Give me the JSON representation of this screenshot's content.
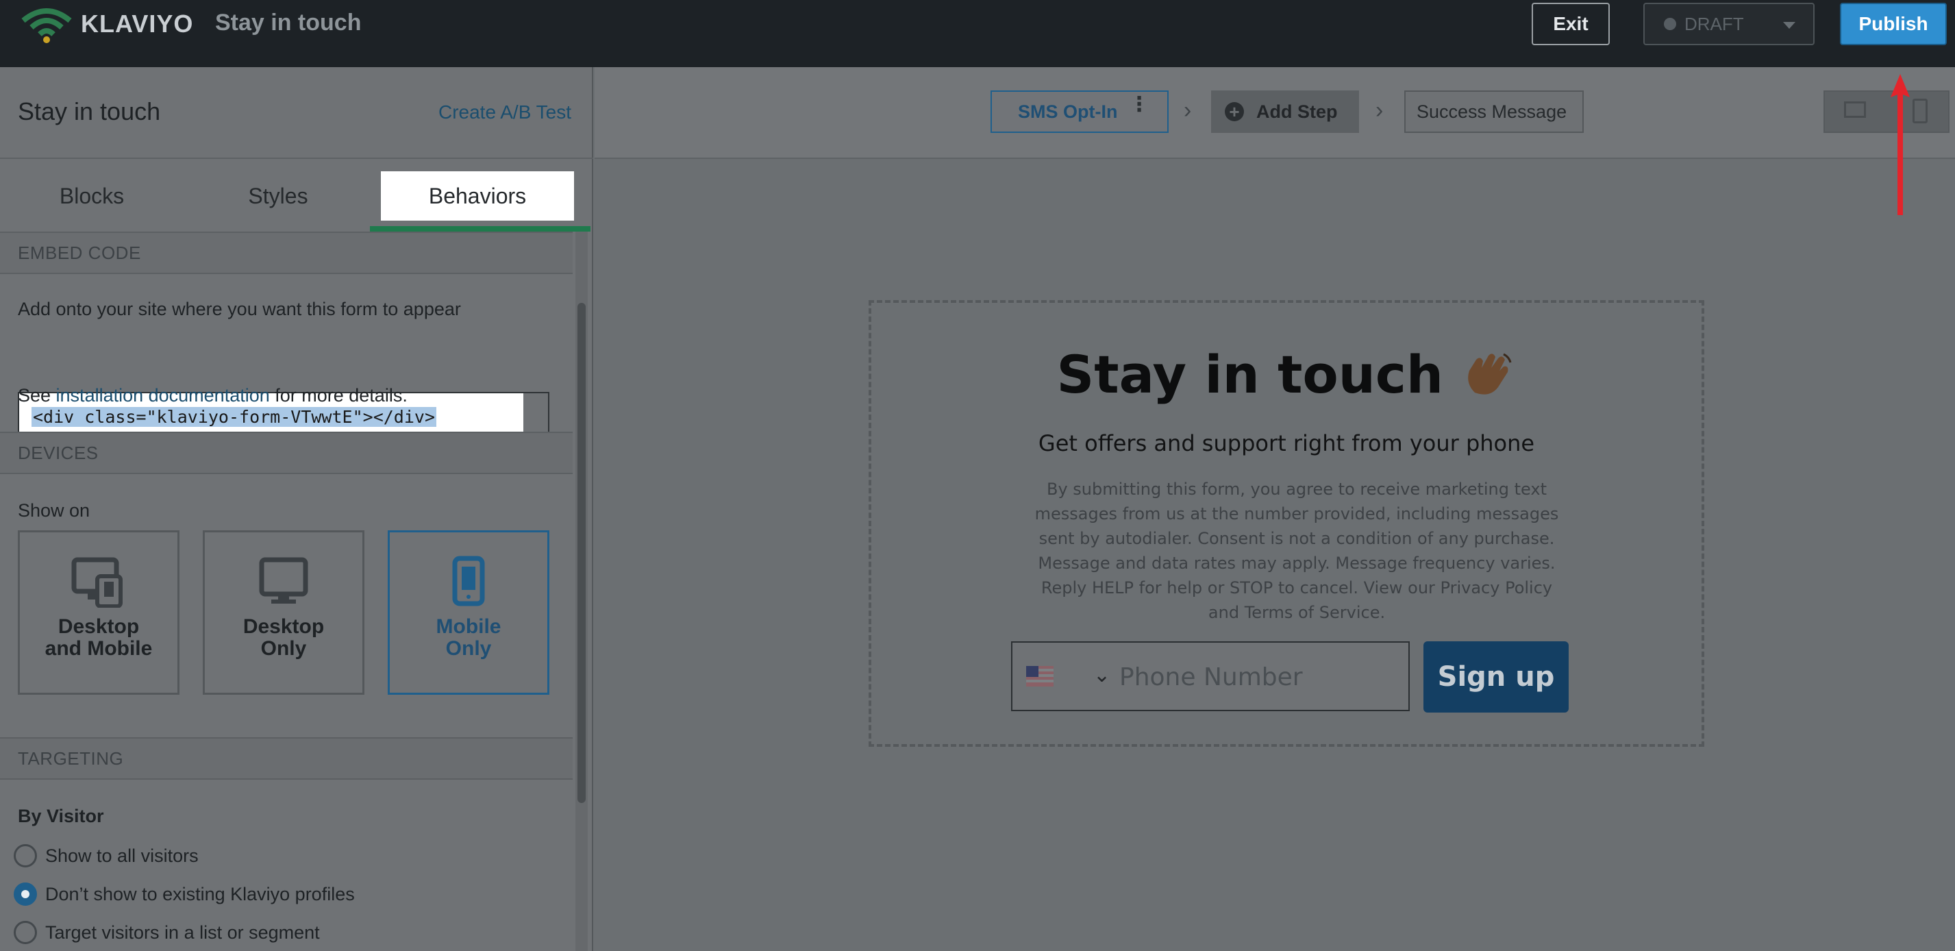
{
  "topbar": {
    "brand": "KLAVIYO",
    "app_title": "Stay in touch",
    "exit_label": "Exit",
    "status_label": "DRAFT",
    "publish_label": "Publish"
  },
  "left_panel": {
    "title": "Stay in touch",
    "ab_test_link": "Create A/B Test",
    "tabs": [
      {
        "label": "Blocks"
      },
      {
        "label": "Styles"
      },
      {
        "label": "Behaviors",
        "active": true
      }
    ],
    "embed": {
      "heading": "EMBED CODE",
      "instruction": "Add onto your site where you want this form to appear",
      "code": "<div class=\"klaviyo-form-VTwwtE\"></div>",
      "see_prefix": "See ",
      "doc_link": "installation documentation",
      "see_suffix": " for more details."
    },
    "devices": {
      "heading": "DEVICES",
      "show_on": "Show on",
      "options": [
        {
          "line1": "Desktop",
          "line2": "and Mobile",
          "icon": "desktop-mobile-icon"
        },
        {
          "line1": "Desktop",
          "line2": "Only",
          "icon": "desktop-icon"
        },
        {
          "line1": "Mobile",
          "line2": "Only",
          "icon": "mobile-icon",
          "selected": true
        }
      ]
    },
    "targeting": {
      "heading": "TARGETING",
      "by_visitor": "By Visitor",
      "options": [
        {
          "label": "Show to all visitors",
          "checked": false
        },
        {
          "label": "Don’t show to existing Klaviyo profiles",
          "checked": true
        },
        {
          "label": "Target visitors in a list or segment",
          "checked": false
        }
      ]
    }
  },
  "editor": {
    "steps": [
      {
        "label": "SMS Opt-In"
      },
      {
        "label": "Add Step"
      },
      {
        "label": "Success Message"
      }
    ],
    "form": {
      "title": "Stay in touch",
      "subtitle": "Get offers and support right from your phone",
      "legal": "By submitting this form, you agree to receive marketing text messages from us at the number provided, including messages sent by autodialer. Consent is not a condition of any purchase. Message and data rates may apply. Message frequency varies. Reply HELP for help or STOP to cancel. View our Privacy Policy and Terms of Service.",
      "phone_placeholder": "Phone Number",
      "signup_label": "Sign up"
    }
  },
  "colors": {
    "topbar_bg": "#1d2226",
    "publish_bg": "#2f8fd0",
    "selected_border": "#1f5f8c",
    "tab_underline": "#1f7a4d",
    "signup_bg": "#143f63",
    "annotation_arrow": "#e3242b"
  }
}
